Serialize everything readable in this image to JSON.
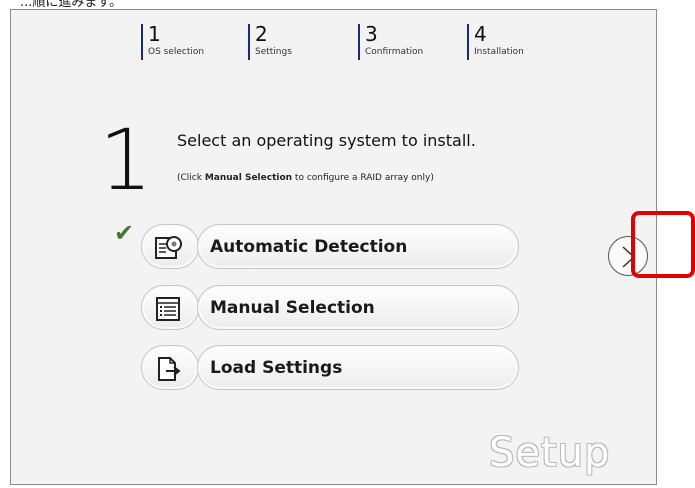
{
  "caption": "...順に進みます。",
  "steps": [
    {
      "number": "1",
      "label": "OS selection"
    },
    {
      "number": "2",
      "label": "Settings"
    },
    {
      "number": "3",
      "label": "Confirmation"
    },
    {
      "number": "4",
      "label": "Installation"
    }
  ],
  "main": {
    "big_number": "1",
    "instruction": "Select an operating system to install.",
    "note_prefix": "(Click ",
    "note_bold": "Manual Selection",
    "note_suffix": " to configure a RAID array only)"
  },
  "options": [
    {
      "label": "Automatic Detection",
      "icon": "auto-detect-disk-icon",
      "selected": true
    },
    {
      "label": "Manual Selection",
      "icon": "list-icon",
      "selected": false
    },
    {
      "label": "Load Settings",
      "icon": "load-file-icon",
      "selected": false
    }
  ],
  "selected_marker": "✔",
  "next_icon": "chevron-right-icon",
  "logo_text": "Setup",
  "colors": {
    "step_bar": "#1c2a7c",
    "check": "#3e7a2f",
    "highlight": "#e10000"
  }
}
